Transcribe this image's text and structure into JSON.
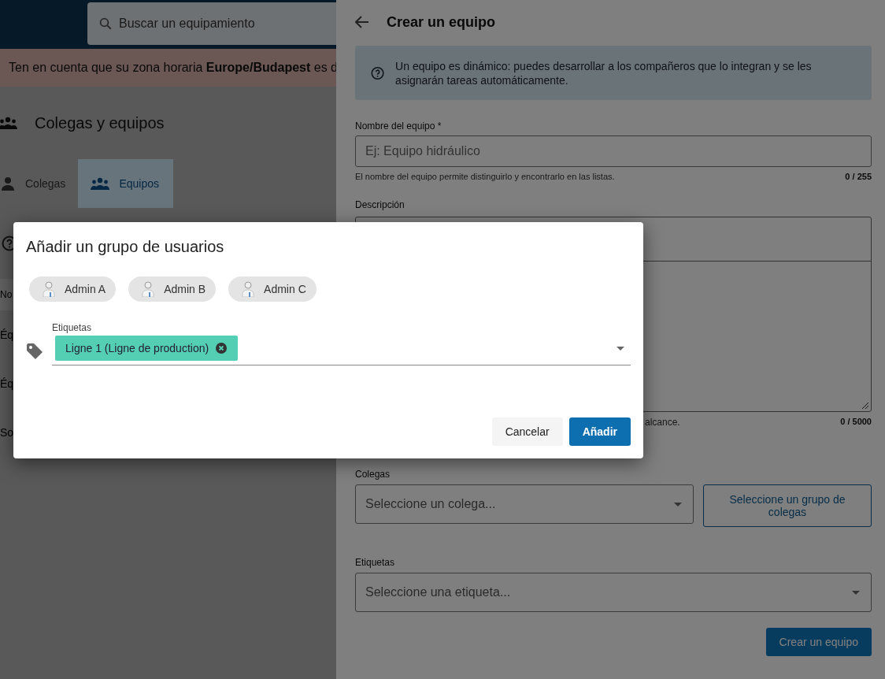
{
  "app_header": {
    "search": {
      "placeholder": "Buscar un equipamiento"
    }
  },
  "notice": "Ten en cuenta que su zona horaria **Europe/Budapest** es d",
  "page": {
    "title": "Colegas y equipos",
    "tabs": [
      {
        "label": "Colegas",
        "kind": "person",
        "selected": false
      },
      {
        "label": "Equipos",
        "kind": "group",
        "selected": true
      }
    ],
    "table": {
      "column_1": "No",
      "rows": [
        "Éq",
        "Éq",
        "So"
      ]
    }
  },
  "drawer": {
    "title": "Crear un equipo",
    "info": "Un equipo es dinámico: puedes desarrollar a los compañeros que lo integran y se les asignarán tareas automáticamente.",
    "name_field": {
      "label": "Nombre del equipo *",
      "placeholder": "Ej: Equipo hidráulico",
      "hint": "El nombre del equipo permite distinguirlo y encontrarlo en las listas.",
      "counter": "0 / 255"
    },
    "description": {
      "label": "Descripción",
      "hint": "alcance.",
      "counter": "0 / 5000"
    },
    "colleagues": {
      "label": "Colegas",
      "placeholder": "Seleccione un colega...",
      "group_button": "Seleccione un grupo de colegas"
    },
    "tags": {
      "label": "Etiquetas",
      "placeholder": "Seleccione una etiqueta..."
    },
    "submit": "Crear un equipo"
  },
  "dialog": {
    "title": "Añadir un grupo de usuarios",
    "users": [
      {
        "name": "Admin A"
      },
      {
        "name": "Admin B"
      },
      {
        "name": "Admin C"
      }
    ],
    "tags_field": {
      "label": "Etiquetas",
      "chips": [
        {
          "label": "Ligne 1 (Ligne de production)"
        }
      ]
    },
    "buttons": [
      {
        "label": "Cancelar",
        "kind": "secondary"
      },
      {
        "label": "Añadir",
        "kind": "primary"
      }
    ]
  }
}
